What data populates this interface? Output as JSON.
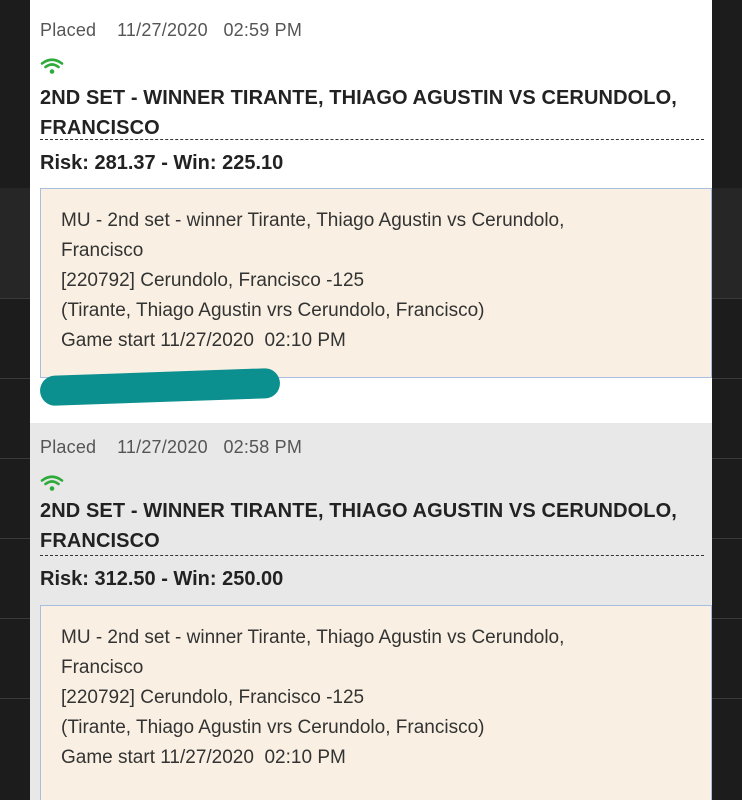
{
  "bets": [
    {
      "status": "Placed",
      "date": "11/27/2020",
      "time": "02:59 PM",
      "signal_icon": "wifi-icon",
      "title_line1": "2ND SET - WINNER TIRANTE, THIAGO AGUSTIN VS CERUNDOLO,",
      "title_line2": "FRANCISCO",
      "risk_win": "Risk: 281.37 - Win: 225.10",
      "detail": [
        "MU - 2nd set - winner Tirante, Thiago Agustin vs Cerundolo,",
        "Francisco",
        "[220792] Cerundolo, Francisco -125",
        "(Tirante, Thiago Agustin vrs Cerundolo, Francisco)",
        "Game start 11/27/2020  02:10 PM"
      ]
    },
    {
      "status": "Placed",
      "date": "11/27/2020",
      "time": "02:58 PM",
      "signal_icon": "wifi-icon",
      "title_line1": "2ND SET - WINNER TIRANTE, THIAGO AGUSTIN VS CERUNDOLO,",
      "title_line2": "FRANCISCO",
      "risk_win": "Risk: 312.50 - Win: 250.00",
      "detail": [
        "MU - 2nd set - winner Tirante, Thiago Agustin vs Cerundolo,",
        "Francisco",
        "[220792] Cerundolo, Francisco -125",
        "(Tirante, Thiago Agustin vrs Cerundolo, Francisco)",
        "Game start 11/27/2020  02:10 PM"
      ]
    }
  ],
  "colors": {
    "signal": "#2eaa3a",
    "detail_bg": "#f9f0e3",
    "detail_border": "#a9bde0",
    "redaction": "#0b8f8f"
  }
}
